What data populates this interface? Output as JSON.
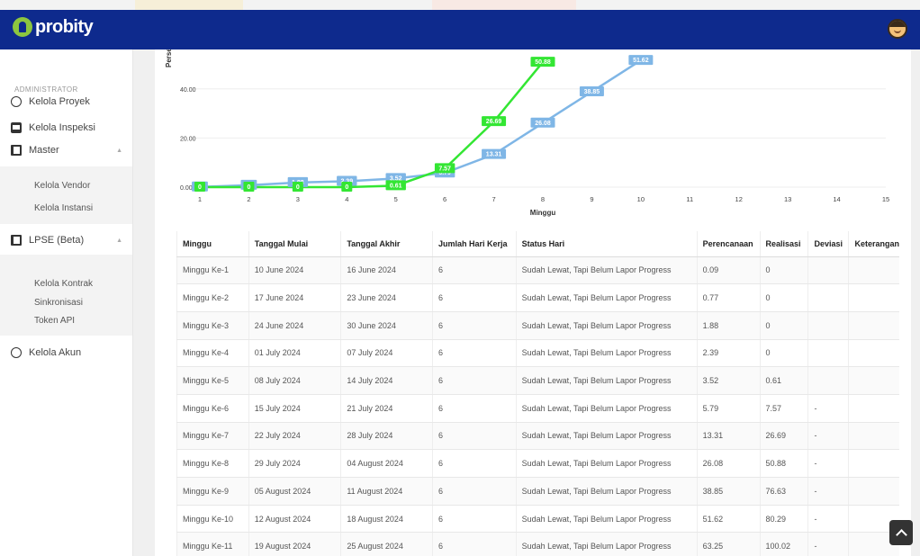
{
  "app": {
    "logo_text": "probity"
  },
  "sidebar": {
    "header": "ADMINISTRATOR",
    "items": [
      {
        "label": "Kelola Proyek",
        "icon": "circle-icon"
      },
      {
        "label": "Kelola Inspeksi",
        "icon": "inspection-icon"
      },
      {
        "label": "Master",
        "icon": "master-icon",
        "caret": "▲",
        "children": [
          "Kelola Vendor",
          "Kelola Instansi"
        ]
      },
      {
        "label": "LPSE (Beta)",
        "icon": "lpse-icon",
        "caret": "▲",
        "children": [
          "Kelola Kontrak",
          "Sinkronisasi",
          "Token API"
        ]
      },
      {
        "label": "Kelola Akun",
        "icon": "account-icon"
      }
    ]
  },
  "chart_data": {
    "type": "line",
    "ylabel": "Persen",
    "xlabel": "Minggu",
    "x": [
      1,
      2,
      3,
      4,
      5,
      6,
      7,
      8,
      9,
      10,
      11,
      12,
      13,
      14,
      15
    ],
    "y_ticks": [
      "0.00",
      "20.00",
      "40.00"
    ],
    "ylim": [
      0,
      55
    ],
    "series": [
      {
        "name": "Perencanaan",
        "color": "#7fb6e6",
        "points": [
          [
            1,
            0.09
          ],
          [
            2,
            0.77
          ],
          [
            3,
            1.88
          ],
          [
            4,
            2.39
          ],
          [
            5,
            3.52
          ],
          [
            6,
            5.79
          ],
          [
            7,
            13.31
          ],
          [
            8,
            26.08
          ],
          [
            9,
            38.85
          ],
          [
            10,
            51.62
          ]
        ],
        "labels": [
          [
            "1",
            0.09,
            "0.0"
          ],
          [
            "2",
            0.77,
            "0.7"
          ],
          [
            "3",
            1.88,
            "1.88"
          ],
          [
            "4",
            2.39,
            "2.39"
          ],
          [
            "5",
            3.52,
            "3.52"
          ],
          [
            "6",
            5.79,
            "5.79"
          ],
          [
            "7",
            13.31,
            "13.31"
          ],
          [
            "8",
            26.08,
            "26.08"
          ],
          [
            "9",
            38.85,
            "38.85"
          ],
          [
            "10",
            51.62,
            "51.62"
          ]
        ]
      },
      {
        "name": "Realisasi",
        "color": "#33e633",
        "points": [
          [
            1,
            0
          ],
          [
            2,
            0
          ],
          [
            3,
            0
          ],
          [
            4,
            0
          ],
          [
            5,
            0.61
          ],
          [
            6,
            7.57
          ],
          [
            7,
            26.69
          ],
          [
            8,
            50.88
          ]
        ],
        "labels": [
          [
            "1",
            0,
            "0"
          ],
          [
            "2",
            0,
            "0"
          ],
          [
            "3",
            0,
            "0"
          ],
          [
            "4",
            0,
            "0"
          ],
          [
            "5",
            0.61,
            "0.61"
          ],
          [
            "6",
            7.57,
            "7.57"
          ],
          [
            "7",
            26.69,
            "26.69"
          ],
          [
            "8",
            50.88,
            "50.88"
          ]
        ]
      }
    ]
  },
  "table": {
    "headers": [
      "Minggu",
      "Tanggal Mulai",
      "Tanggal Akhir",
      "Jumlah Hari Kerja",
      "Status Hari",
      "Perencanaan",
      "Realisasi",
      "Deviasi",
      "Keterangan"
    ],
    "rows": [
      [
        "Minggu Ke-1",
        "10 June 2024",
        "16 June 2024",
        "6",
        "Sudah Lewat, Tapi Belum Lapor Progress",
        "0.09",
        "0",
        "",
        ""
      ],
      [
        "Minggu Ke-2",
        "17 June 2024",
        "23 June 2024",
        "6",
        "Sudah Lewat, Tapi Belum Lapor Progress",
        "0.77",
        "0",
        "",
        ""
      ],
      [
        "Minggu Ke-3",
        "24 June 2024",
        "30 June 2024",
        "6",
        "Sudah Lewat, Tapi Belum Lapor Progress",
        "1.88",
        "0",
        "",
        ""
      ],
      [
        "Minggu Ke-4",
        "01 July 2024",
        "07 July 2024",
        "6",
        "Sudah Lewat, Tapi Belum Lapor Progress",
        "2.39",
        "0",
        "",
        ""
      ],
      [
        "Minggu Ke-5",
        "08 July 2024",
        "14 July 2024",
        "6",
        "Sudah Lewat, Tapi Belum Lapor Progress",
        "3.52",
        "0.61",
        "",
        ""
      ],
      [
        "Minggu Ke-6",
        "15 July 2024",
        "21 July 2024",
        "6",
        "Sudah Lewat, Tapi Belum Lapor Progress",
        "5.79",
        "7.57",
        "-",
        ""
      ],
      [
        "Minggu Ke-7",
        "22 July 2024",
        "28 July 2024",
        "6",
        "Sudah Lewat, Tapi Belum Lapor Progress",
        "13.31",
        "26.69",
        "-",
        ""
      ],
      [
        "Minggu Ke-8",
        "29 July 2024",
        "04 August 2024",
        "6",
        "Sudah Lewat, Tapi Belum Lapor Progress",
        "26.08",
        "50.88",
        "-",
        ""
      ],
      [
        "Minggu Ke-9",
        "05 August 2024",
        "11 August 2024",
        "6",
        "Sudah Lewat, Tapi Belum Lapor Progress",
        "38.85",
        "76.63",
        "-",
        ""
      ],
      [
        "Minggu Ke-10",
        "12 August 2024",
        "18 August 2024",
        "6",
        "Sudah Lewat, Tapi Belum Lapor Progress",
        "51.62",
        "80.29",
        "-",
        ""
      ],
      [
        "Minggu Ke-11",
        "19 August 2024",
        "25 August 2024",
        "6",
        "Sudah Lewat, Tapi Belum Lapor Progress",
        "63.25",
        "100.02",
        "-",
        ""
      ]
    ]
  },
  "colors": {
    "navbar": "#0e2a8d",
    "accent": "#8dc63f",
    "plan_line": "#7fb6e6",
    "real_line": "#33e633"
  }
}
